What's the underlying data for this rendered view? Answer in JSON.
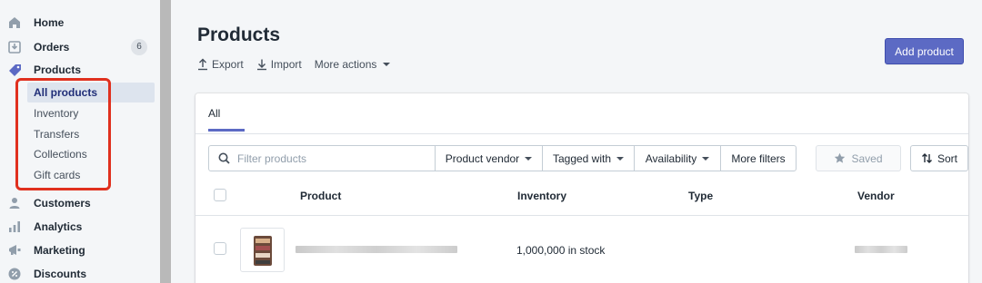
{
  "sidebar": {
    "items": [
      {
        "label": "Home",
        "icon": "home-icon"
      },
      {
        "label": "Orders",
        "icon": "orders-icon",
        "badge": "6"
      },
      {
        "label": "Products",
        "icon": "tag-icon"
      },
      {
        "label": "Customers",
        "icon": "customer-icon"
      },
      {
        "label": "Analytics",
        "icon": "bar-chart-icon"
      },
      {
        "label": "Marketing",
        "icon": "megaphone-icon"
      },
      {
        "label": "Discounts",
        "icon": "discount-icon"
      }
    ],
    "product_subitems": [
      {
        "label": "All products",
        "active": true
      },
      {
        "label": "Inventory"
      },
      {
        "label": "Transfers"
      },
      {
        "label": "Collections"
      },
      {
        "label": "Gift cards"
      }
    ]
  },
  "header": {
    "title": "Products",
    "export_label": "Export",
    "import_label": "Import",
    "more_actions_label": "More actions",
    "add_button_label": "Add product"
  },
  "tabs": [
    {
      "label": "All",
      "active": true
    }
  ],
  "filters": {
    "search_placeholder": "Filter products",
    "product_vendor": "Product vendor",
    "tagged_with": "Tagged with",
    "availability": "Availability",
    "more_filters": "More filters",
    "saved": "Saved",
    "sort": "Sort"
  },
  "table": {
    "columns": [
      "Product",
      "Inventory",
      "Type",
      "Vendor"
    ],
    "rows": [
      {
        "inventory": "1,000,000 in stock"
      }
    ]
  },
  "colors": {
    "accent": "#5c6ac4",
    "highlight": "#e0301e"
  }
}
